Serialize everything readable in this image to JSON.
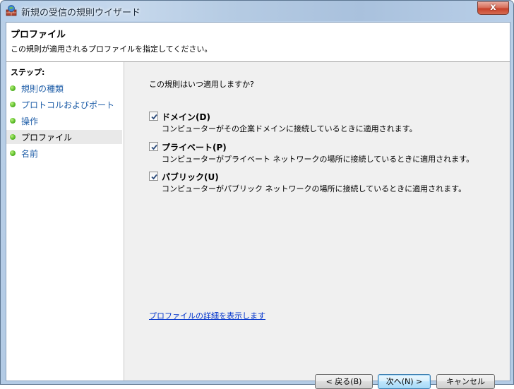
{
  "window": {
    "title": "新規の受信の規則ウイザード",
    "close_label": "x"
  },
  "header": {
    "title": "プロファイル",
    "description": "この規則が適用されるプロファイルを指定してください。"
  },
  "steps": {
    "heading": "ステップ:",
    "items": [
      {
        "label": "規則の種類",
        "current": false
      },
      {
        "label": "プロトコルおよびポート",
        "current": false
      },
      {
        "label": "操作",
        "current": false
      },
      {
        "label": "プロファイル",
        "current": true
      },
      {
        "label": "名前",
        "current": false
      }
    ]
  },
  "main": {
    "question": "この規則はいつ適用しますか?",
    "options": [
      {
        "label": "ドメイン(D)",
        "description": "コンピューターがその企業ドメインに接続しているときに適用されます。",
        "checked": true
      },
      {
        "label": "プライベート(P)",
        "description": "コンピューターがプライベート ネットワークの場所に接続しているときに適用されます。",
        "checked": true
      },
      {
        "label": "パブリック(U)",
        "description": "コンピューターがパブリック ネットワークの場所に接続しているときに適用されます。",
        "checked": true
      }
    ],
    "details_link": "プロファイルの詳細を表示します"
  },
  "buttons": {
    "back": "< 戻る(B)",
    "next": "次へ(N) >",
    "cancel": "キャンセル"
  },
  "colors": {
    "link": "#0033cc",
    "step_link": "#1f5ea8",
    "step_dot": "#5cbd2a"
  }
}
